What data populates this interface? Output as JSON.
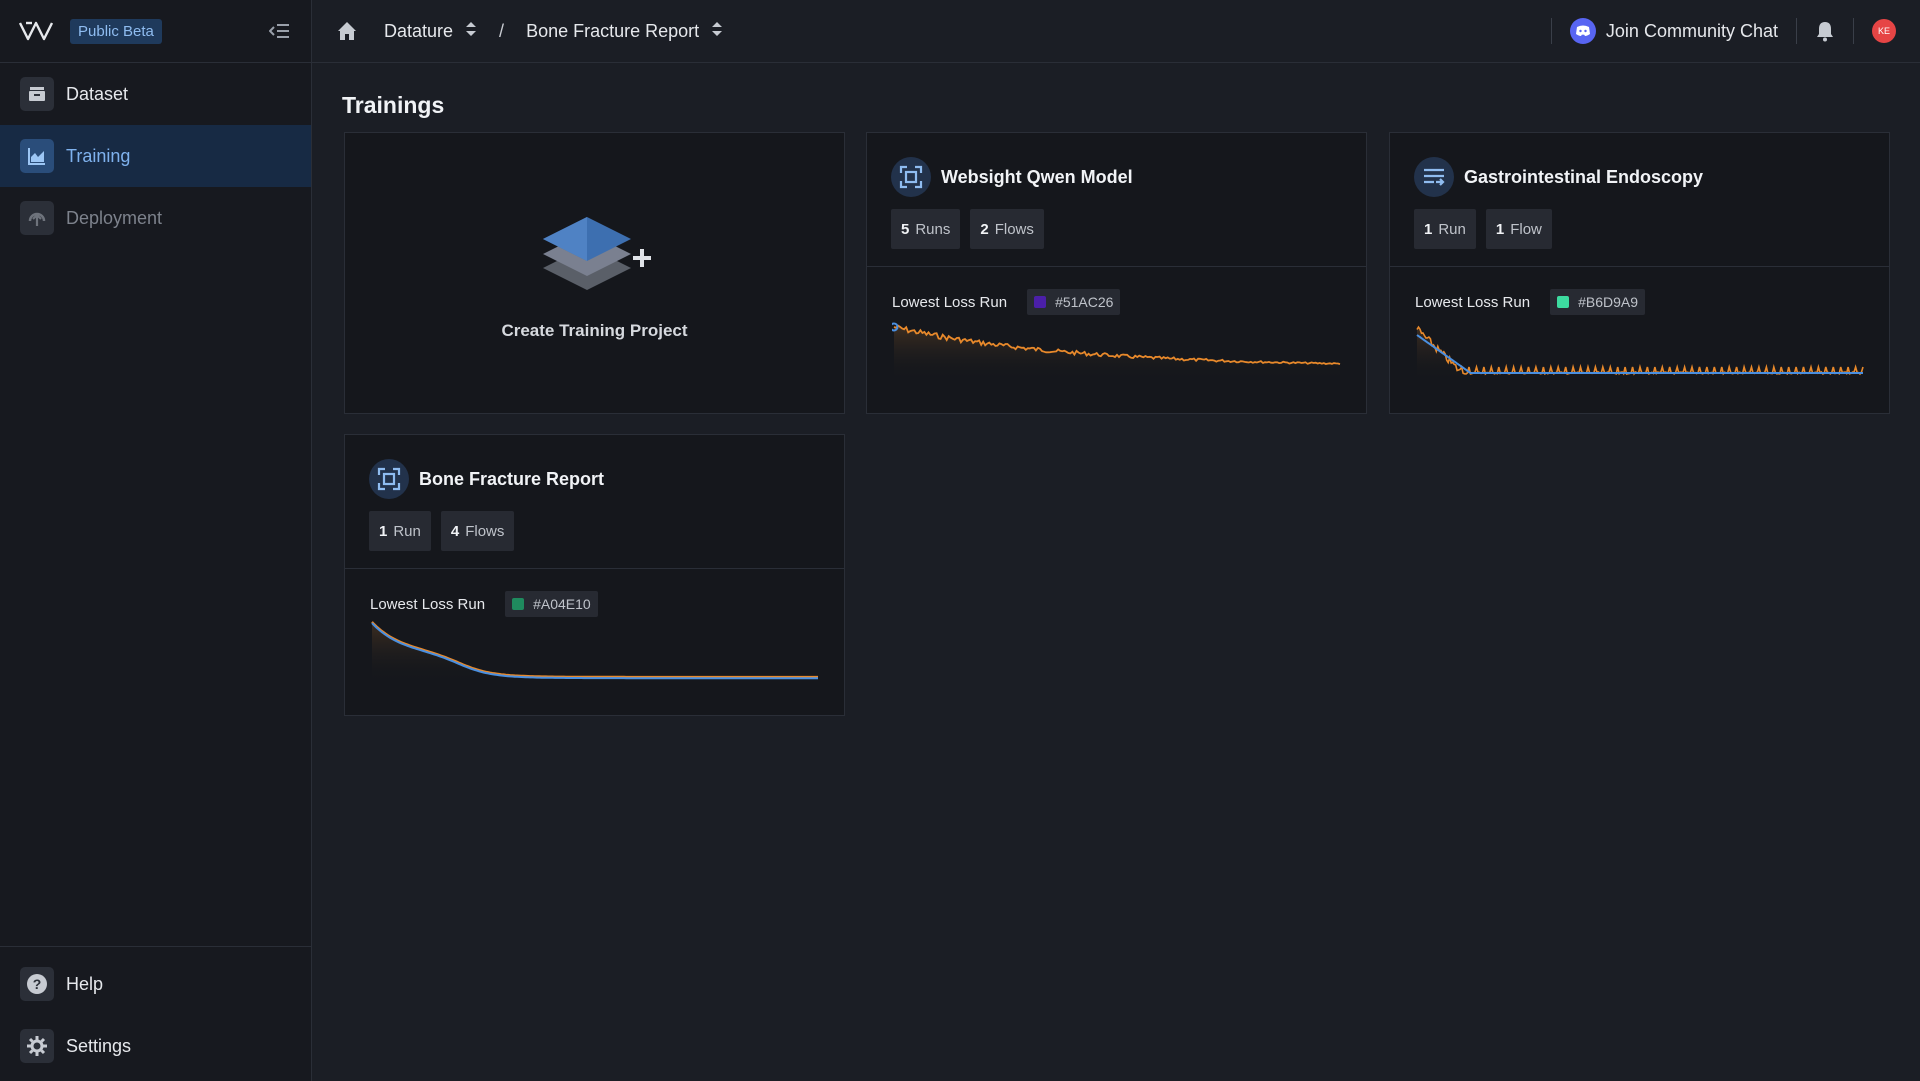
{
  "app": {
    "badge": "Public Beta"
  },
  "sidebar": {
    "items": [
      {
        "label": "Dataset",
        "icon": "dataset-icon"
      },
      {
        "label": "Training",
        "icon": "training-chart-icon",
        "active": true
      },
      {
        "label": "Deployment",
        "icon": "deployment-icon",
        "disabled": true
      }
    ],
    "bottom": [
      {
        "label": "Help",
        "icon": "help-icon"
      },
      {
        "label": "Settings",
        "icon": "gear-icon"
      }
    ]
  },
  "topbar": {
    "breadcrumb": [
      {
        "label": "Datature"
      },
      {
        "label": "Bone Fracture Report"
      }
    ],
    "separator": "/",
    "community": "Join Community Chat",
    "avatar_initials": "KE"
  },
  "main": {
    "title": "Trainings",
    "create_label": "Create Training Project",
    "projects": [
      {
        "name": "Websight Qwen Model",
        "icon": "focus-frame-icon",
        "runs_count": "5",
        "runs_label": "Runs",
        "flows_count": "2",
        "flows_label": "Flows",
        "lowest_loss_label": "Lowest Loss Run",
        "run_id": "#51AC26",
        "run_color": "#4b1fa8"
      },
      {
        "name": "Gastrointestinal Endoscopy",
        "icon": "list-arrow-icon",
        "runs_count": "1",
        "runs_label": "Run",
        "flows_count": "1",
        "flows_label": "Flow",
        "lowest_loss_label": "Lowest Loss Run",
        "run_id": "#B6D9A9",
        "run_color": "#3ddba0"
      },
      {
        "name": "Bone Fracture Report",
        "icon": "focus-frame-icon",
        "runs_count": "1",
        "runs_label": "Run",
        "flows_count": "4",
        "flows_label": "Flows",
        "lowest_loss_label": "Lowest Loss Run",
        "run_id": "#A04E10",
        "run_color": "#1f8a5e"
      }
    ]
  },
  "colors": {
    "accent": "#7fb2ee",
    "loss_orange": "#e8892b",
    "loss_blue": "#4a8fe0",
    "background": "#1b1e25"
  }
}
